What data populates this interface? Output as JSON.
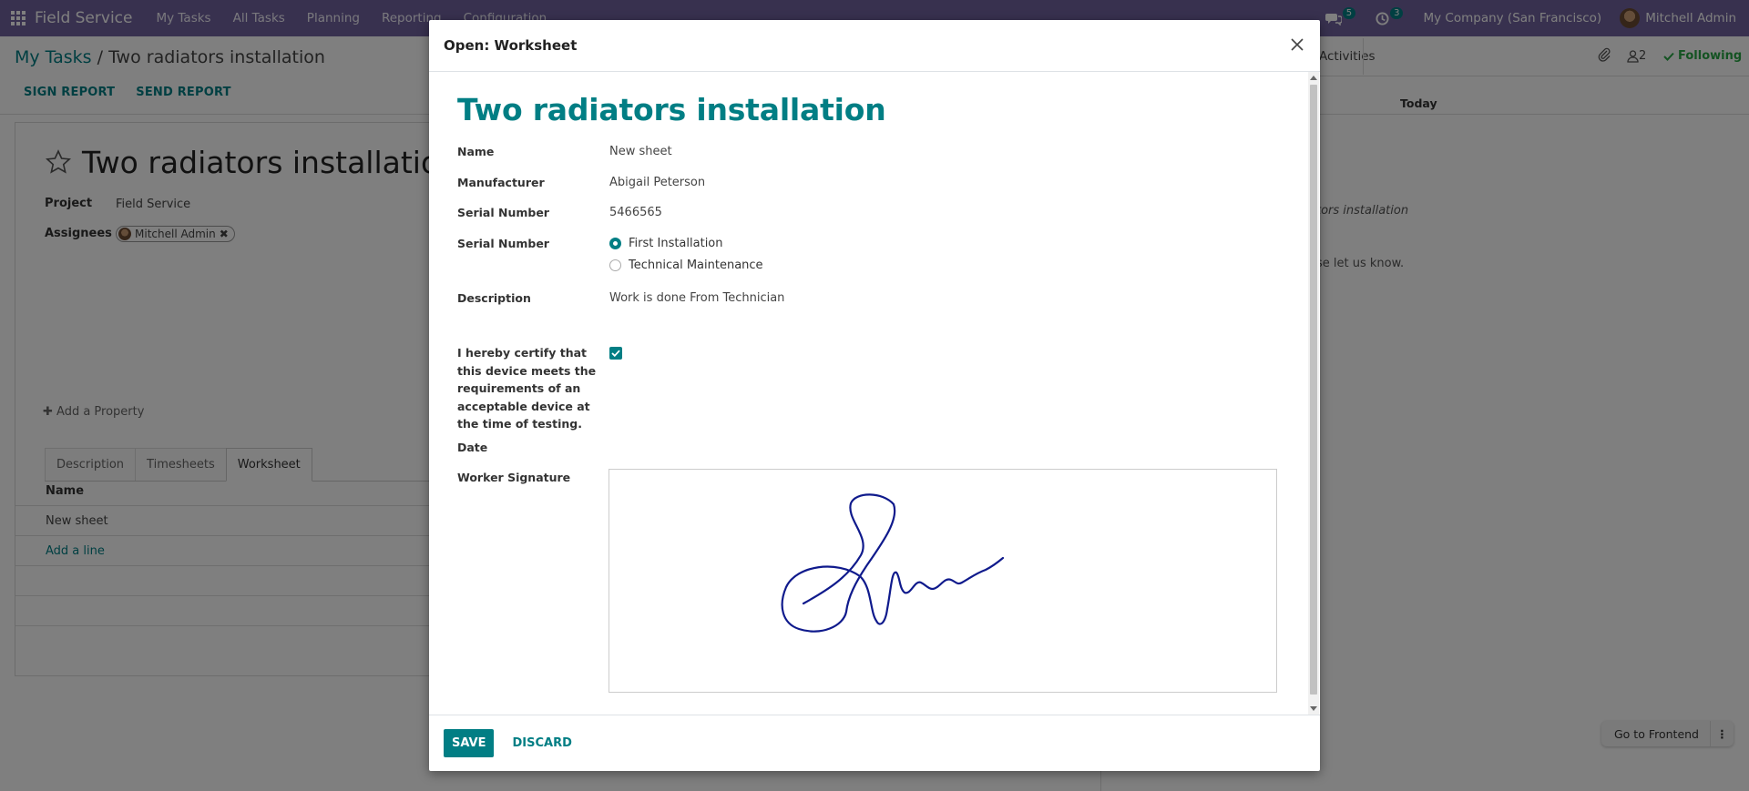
{
  "navbar": {
    "app_name": "Field Service",
    "menus": [
      "My Tasks",
      "All Tasks",
      "Planning",
      "Reporting",
      "Configuration"
    ],
    "messages_count": "5",
    "activities_count": "3",
    "company": "My Company (San Francisco)",
    "user": "Mitchell Admin"
  },
  "breadcrumb": {
    "parent": "My Tasks",
    "separator": "/",
    "current": "Two radiators installation"
  },
  "actions": {
    "sign_report": "SIGN REPORT",
    "send_report": "SEND REPORT"
  },
  "task": {
    "title": "Two radiators installation",
    "project_label": "Project",
    "project_value": "Field Service",
    "assignees_label": "Assignees",
    "assignee": "Mitchell Admin",
    "add_property": "Add a Property",
    "tabs": [
      "Description",
      "Timesheets",
      "Worksheet"
    ],
    "active_tab": "Worksheet",
    "list_header": "Name",
    "list_rows": [
      "New sheet"
    ],
    "add_line": "Add a line"
  },
  "chatter": {
    "activities": "Activities",
    "followers_count": "2",
    "following": "Following",
    "today": "Today",
    "snippet1": "tors installation",
    "snippet2": "se let us know."
  },
  "frontend_button": {
    "label": "Go to Frontend"
  },
  "modal": {
    "title": "Open: Worksheet",
    "heading": "Two radiators installation",
    "fields": {
      "name_label": "Name",
      "name_value": "New sheet",
      "manufacturer_label": "Manufacturer",
      "manufacturer_value": "Abigail Peterson",
      "serial_label": "Serial Number",
      "serial_value": "5466565",
      "type_label": "Serial Number",
      "type_options": [
        "First Installation",
        "Technical Maintenance"
      ],
      "type_selected": "First Installation",
      "description_label": "Description",
      "description_value": "Work is done From Technician",
      "certify_label": "I hereby certify that this device meets the requirements of an acceptable device at the time of testing.",
      "certify_checked": true,
      "date_label": "Date",
      "signature_label": "Worker Signature"
    },
    "save": "SAVE",
    "discard": "DISCARD"
  },
  "colors": {
    "navbar": "#71639e",
    "primary": "#017e84",
    "signature_ink": "#0f1a8c",
    "following": "#28a745"
  }
}
